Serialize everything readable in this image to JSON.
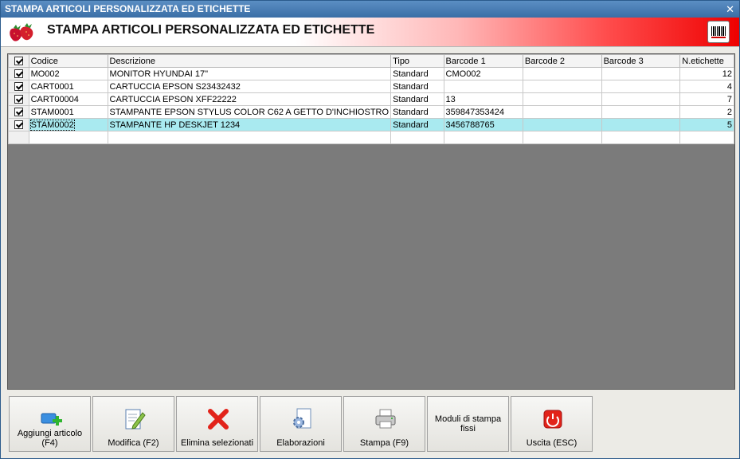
{
  "window": {
    "title": "STAMPA ARTICOLI PERSONALIZZATA ED ETICHETTE",
    "close_glyph": "✕"
  },
  "header": {
    "title": "STAMPA ARTICOLI PERSONALIZZATA ED ETICHETTE",
    "logo_icon": "strawberry-icon",
    "right_icon": "barcode-icon"
  },
  "grid": {
    "columns": [
      "Codice",
      "Descrizione",
      "Tipo",
      "Barcode 1",
      "Barcode 2",
      "Barcode 3",
      "N.etichette"
    ],
    "rows": [
      {
        "checked": true,
        "codice": "MO002",
        "descrizione": "MONITOR HYUNDAI 17\"",
        "tipo": "Standard",
        "barcode1": "CMO002",
        "barcode2": "",
        "barcode3": "",
        "netichette": "12"
      },
      {
        "checked": true,
        "codice": "CART0001",
        "descrizione": "CARTUCCIA EPSON S23432432",
        "tipo": "Standard",
        "barcode1": "",
        "barcode2": "",
        "barcode3": "",
        "netichette": "4"
      },
      {
        "checked": true,
        "codice": "CART00004",
        "descrizione": "CARTUCCIA EPSON XFF22222",
        "tipo": "Standard",
        "barcode1": "13",
        "barcode2": "",
        "barcode3": "",
        "netichette": "7"
      },
      {
        "checked": true,
        "codice": "STAM0001",
        "descrizione": "STAMPANTE EPSON STYLUS COLOR C62 A GETTO D'INCHIOSTRO",
        "tipo": "Standard",
        "barcode1": "359847353424",
        "barcode2": "",
        "barcode3": "",
        "netichette": "2"
      },
      {
        "checked": true,
        "codice": "STAM0002",
        "descrizione": "STAMPANTE HP DESKJET 1234",
        "tipo": "Standard",
        "barcode1": "3456788765",
        "barcode2": "",
        "barcode3": "",
        "netichette": "5",
        "selected": true
      }
    ]
  },
  "toolbar": {
    "add": {
      "label": "Aggiungi articolo (F4)",
      "icon": "add-item-icon"
    },
    "edit": {
      "label": "Modifica (F2)",
      "icon": "edit-icon"
    },
    "delete": {
      "label": "Elimina selezionati",
      "icon": "delete-x-icon"
    },
    "process": {
      "label": "Elaborazioni",
      "icon": "gear-document-icon"
    },
    "print": {
      "label": "Stampa (F9)",
      "icon": "printer-icon"
    },
    "fixed_modules": {
      "label": "Moduli di stampa fissi"
    },
    "exit": {
      "label": "Uscita (ESC)",
      "icon": "power-icon"
    }
  },
  "colors": {
    "selected_row": "#a9eaf0",
    "header_gradient_end": "#ee0000",
    "grid_background": "#7b7b7b"
  }
}
